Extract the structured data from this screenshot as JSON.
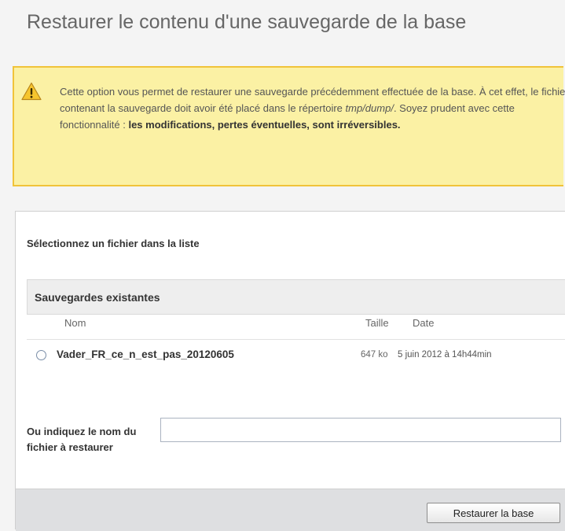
{
  "page": {
    "title": "Restaurer le contenu d'une sauvegarde de la base"
  },
  "warning": {
    "icon": "warning-icon",
    "colors": {
      "background": "#fbf1a4",
      "border": "#f0c33a"
    },
    "text_before_path": "Cette option vous permet de restaurer une sauvegarde précédemment effectuée de la base. À cet effet, le fichier contenant la sauvegarde doit avoir été placé dans le répertoire ",
    "path": "tmp/dump/",
    "text_after_path": ". Soyez prudent avec cette fonctionnalité : ",
    "emphasis": "les modifications, pertes éventuelles, sont irréversibles."
  },
  "form": {
    "subtitle": "Sélectionnez un fichier dans la liste",
    "backups": {
      "title": "Sauvegardes existantes",
      "columns": {
        "name": "Nom",
        "size": "Taille",
        "date": "Date"
      },
      "rows": [
        {
          "name": "Vader_FR_ce_n_est_pas_20120605",
          "size": "647 ko",
          "date": "5 juin 2012 à 14h44min",
          "selected": false
        }
      ]
    },
    "manual_label": "Ou indiquez le nom du fichier à restaurer",
    "manual_input_value": "",
    "submit_label": "Restaurer la base"
  }
}
